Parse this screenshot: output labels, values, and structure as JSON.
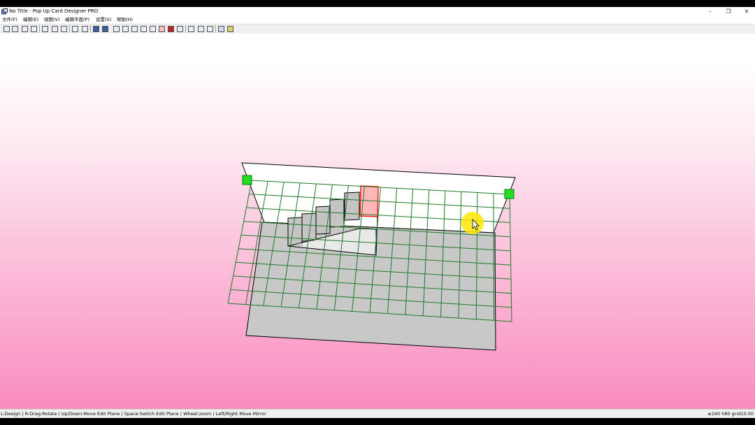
{
  "window": {
    "title": "No Title - Pop Up Card Designer PRO",
    "buttons": {
      "minimize": "–",
      "maximize": "❐",
      "close": "✕"
    }
  },
  "menu": {
    "items": [
      "文件(F)",
      "编辑(E)",
      "视图(V)",
      "编辑平面(P)",
      "设置(S)",
      "帮助(H)"
    ]
  },
  "toolbar": {
    "icons": [
      "new-icon",
      "open-icon",
      "save-icon",
      "print-icon",
      "fit-icon",
      "cut-icon",
      "undo-icon",
      "copy-icon",
      "paste-icon",
      "design-view-icon",
      "3d-view-icon",
      "polygon-icon",
      "rectangle-icon",
      "fold-icon",
      "path-icon",
      "arrow-icon",
      "layer-icon",
      "delete-icon",
      "text-icon",
      "snap-icon",
      "mirror-icon",
      "settings-icon",
      "grid-toggle-icon",
      "help-icon"
    ]
  },
  "status": {
    "hint": "L:Design | R-Drag:Rotate | Up/Down:Move Edit Plane | Space:Switch Edit Plane | Wheel:zoom | Left/Right Move Mirror",
    "dimensions": "w160 h80 grid10.00"
  },
  "colors": {
    "grid": "#1f7a2a",
    "card": "#c8c8c8",
    "selected": "#ff2222",
    "handle": "#22dd22",
    "cursor_highlight": "#ffe800"
  }
}
